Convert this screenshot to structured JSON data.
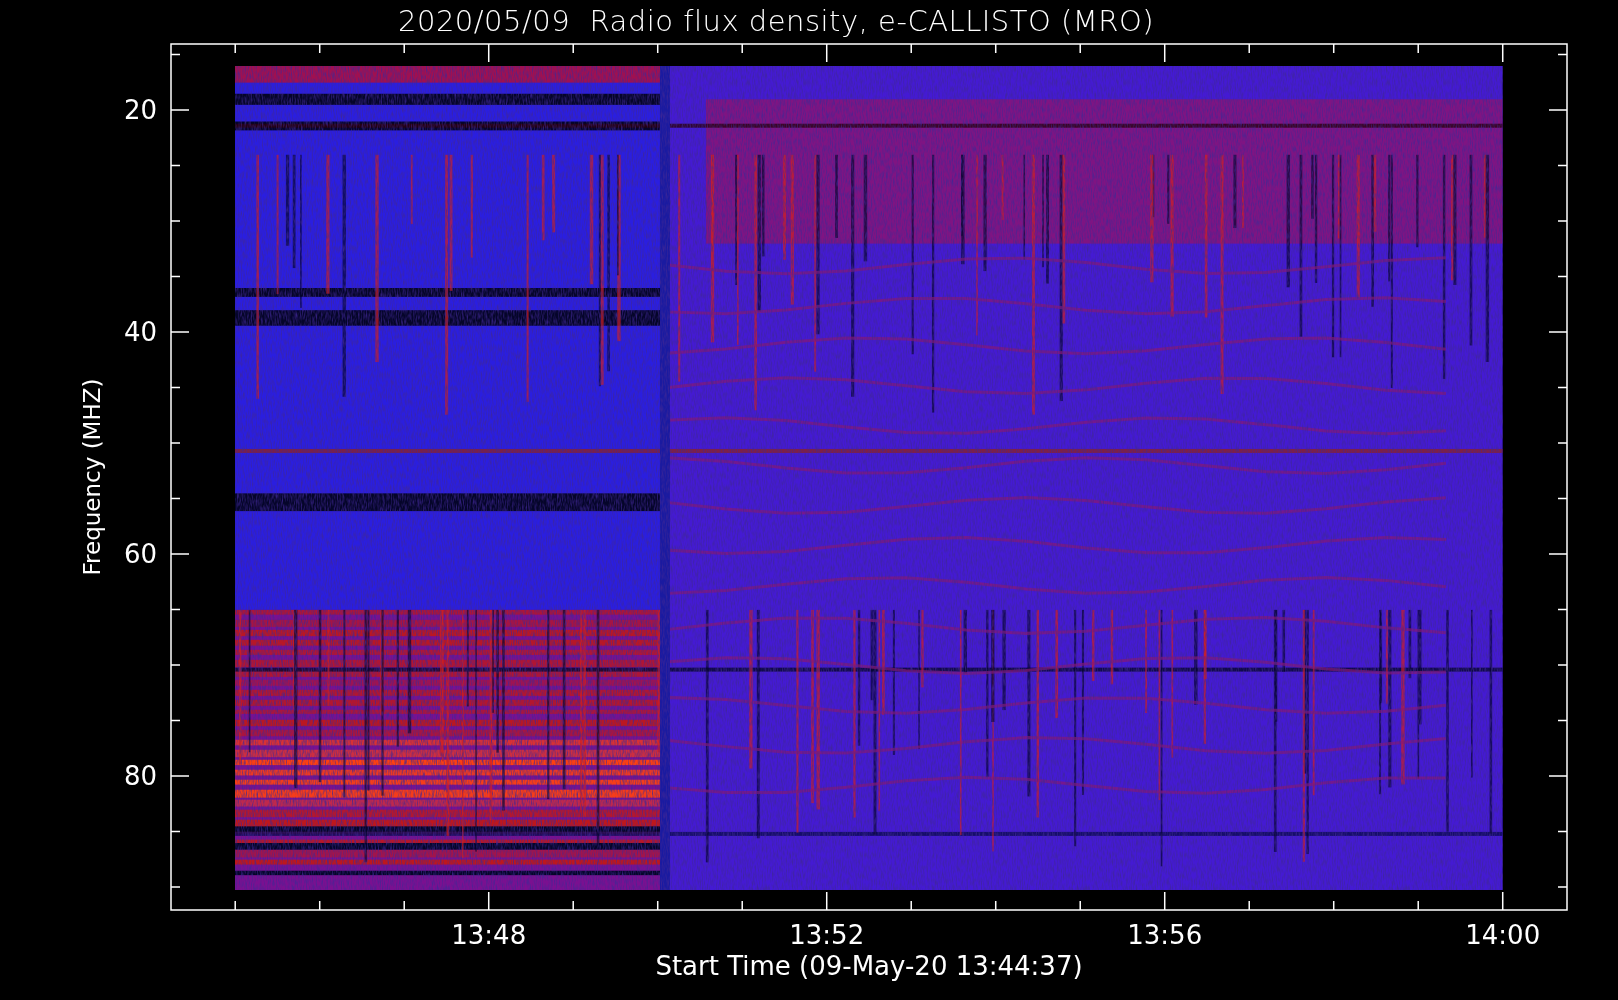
{
  "title": "2020/05/09  Radio flux density, e-CALLISTO (MRO)",
  "plot": {
    "ylabel": "Frequency (MHZ)",
    "y_tick_labels": [
      "20",
      "40",
      "60",
      "80"
    ],
    "x_tick_labels": [
      "13:48",
      "13:52",
      "13:56",
      "14:00"
    ],
    "xlabel": "Start Time (09-May-20 13:44:37)",
    "spectrogram": {
      "kind": "spectrogram"
    }
  }
}
